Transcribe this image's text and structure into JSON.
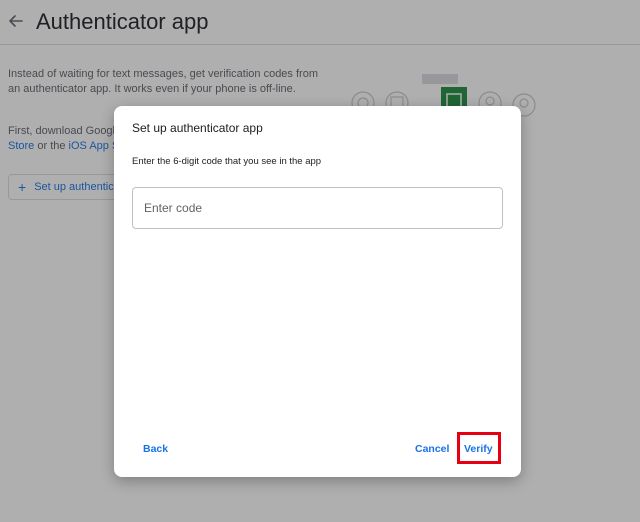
{
  "page": {
    "back_icon": "arrow-left-icon",
    "title": "Authenticator app",
    "description": "Instead of waiting for text messages, get verification codes from an authenticator app. It works even if your phone is off-line.",
    "download_prefix": "First, download Googl",
    "store_link_1": "Store",
    "download_middle": " or the ",
    "store_link_2": "iOS App S",
    "setup_button_icon": "plus-icon",
    "setup_button_label": "Set up authentic"
  },
  "dialog": {
    "title": "Set up authenticator app",
    "instructions": "Enter the 6-digit code that you see in the app",
    "code_field": {
      "placeholder": "Enter code",
      "value": ""
    },
    "back_label": "Back",
    "cancel_label": "Cancel",
    "verify_label": "Verify"
  },
  "colors": {
    "accent": "#1a73e8",
    "highlight": "#e60012",
    "authenticator_green": "#1e8e3e"
  }
}
